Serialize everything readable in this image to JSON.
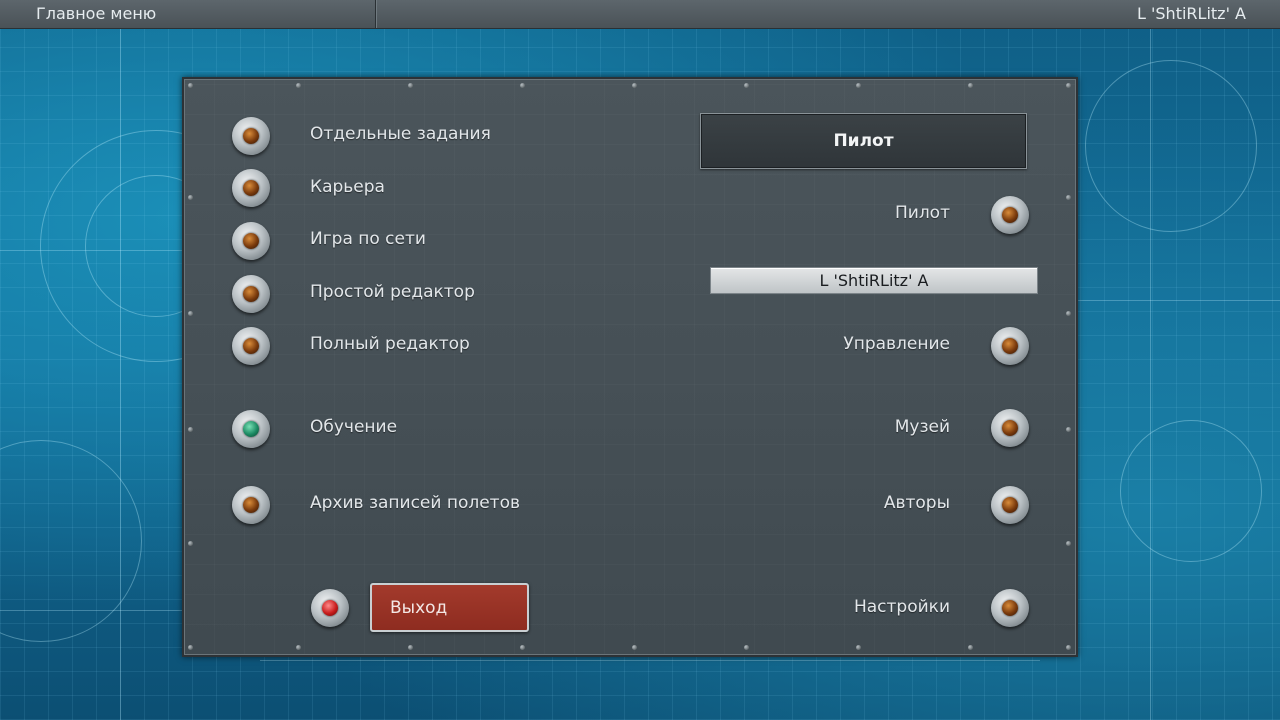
{
  "topbar": {
    "title": "Главное меню",
    "user": "L  'ShtiRLitz' A"
  },
  "left_menu": [
    {
      "label": "Отдельные задания",
      "lamp": "amber"
    },
    {
      "label": "Карьера",
      "lamp": "amber"
    },
    {
      "label": "Игра по сети",
      "lamp": "amber"
    },
    {
      "label": "Простой редактор",
      "lamp": "amber"
    },
    {
      "label": "Полный редактор",
      "lamp": "amber"
    },
    {
      "label": "Обучение",
      "lamp": "green"
    },
    {
      "label": "Архив записей полетов",
      "lamp": "amber"
    }
  ],
  "pilot_panel": {
    "header": "Пилот",
    "name": "L  'ShtiRLitz' A"
  },
  "right_menu": [
    {
      "label": "Пилот",
      "lamp": "amber"
    },
    {
      "label": "Управление",
      "lamp": "amber"
    },
    {
      "label": "Музей",
      "lamp": "amber"
    },
    {
      "label": "Авторы",
      "lamp": "amber"
    },
    {
      "label": "Настройки",
      "lamp": "amber"
    }
  ],
  "exit": {
    "label": "Выход",
    "lamp": "red"
  },
  "colors": {
    "panel": "#465056",
    "exit_button": "#9a3326",
    "background": "#136e99"
  }
}
